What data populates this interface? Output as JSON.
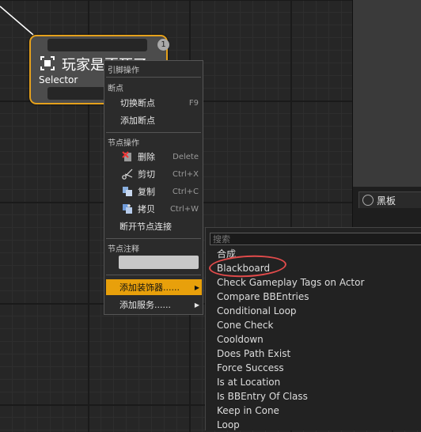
{
  "node": {
    "title": "玩家是否死了",
    "subtitle": "Selector",
    "badge": "1",
    "icon": "selector-icon"
  },
  "context_menu": {
    "header": "引脚操作",
    "breakpoints_section": "断点",
    "toggle_breakpoint": "切换断点",
    "toggle_breakpoint_shortcut": "F9",
    "add_breakpoint": "添加断点",
    "node_actions_section": "节点操作",
    "delete": "删除",
    "delete_shortcut": "Delete",
    "cut": "剪切",
    "cut_shortcut": "Ctrl+X",
    "copy": "复制",
    "copy_shortcut": "Ctrl+C",
    "duplicate": "拷贝",
    "duplicate_shortcut": "Ctrl+W",
    "break_links": "断开节点连接",
    "node_comment_section": "节点注释",
    "add_decorator": "添加装饰器......",
    "add_service": "添加服务......"
  },
  "side_panel": {
    "blackboard_tab": "黑板"
  },
  "decorator_popup": {
    "search_placeholder": "搜索",
    "options": [
      "合成",
      "Blackboard",
      "Check Gameplay Tags on Actor",
      "Compare BBEntries",
      "Conditional Loop",
      "Cone Check",
      "Cooldown",
      "Does Path Exist",
      "Force Success",
      "Is at Location",
      "Is BBEntry Of Class",
      "Keep in Cone",
      "Loop"
    ]
  },
  "colors": {
    "node_border": "#e5a11c",
    "menu_highlight": "#e8a00b",
    "annotation_ellipse": "#e14b4b"
  }
}
